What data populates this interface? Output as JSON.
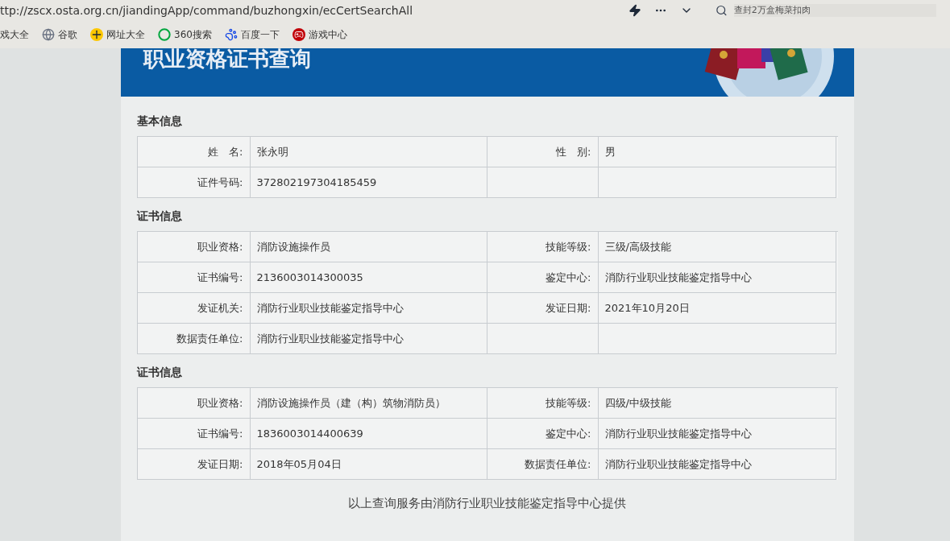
{
  "address_bar": {
    "url": "ttp://zscx.osta.org.cn/jiandingApp/command/buzhongxin/ecCertSearchAll"
  },
  "search": {
    "placeholder": "查封2万盒梅菜扣肉"
  },
  "bookmarks": [
    {
      "label": "戏大全",
      "kind": "none"
    },
    {
      "label": "谷歌",
      "kind": "globe"
    },
    {
      "label": "网址大全",
      "kind": "plus"
    },
    {
      "label": "360搜索",
      "kind": "ring"
    },
    {
      "label": "百度一下",
      "kind": "paw"
    },
    {
      "label": "游戏中心",
      "kind": "game"
    }
  ],
  "page": {
    "title": "职业资格证书查询",
    "sections": [
      {
        "title": "基本信息",
        "rows": [
          [
            {
              "label": "姓　名:",
              "value": "张永明"
            },
            {
              "label": "性　别:",
              "value": "男"
            }
          ],
          [
            {
              "label": "证件号码:",
              "value": "372802197304185459"
            }
          ]
        ]
      },
      {
        "title": "证书信息",
        "rows": [
          [
            {
              "label": "职业资格:",
              "value": "消防设施操作员"
            },
            {
              "label": "技能等级:",
              "value": "三级/高级技能"
            }
          ],
          [
            {
              "label": "证书编号:",
              "value": "2136003014300035"
            },
            {
              "label": "鉴定中心:",
              "value": "消防行业职业技能鉴定指导中心"
            }
          ],
          [
            {
              "label": "发证机关:",
              "value": "消防行业职业技能鉴定指导中心"
            },
            {
              "label": "发证日期:",
              "value": "2021年10月20日"
            }
          ],
          [
            {
              "label": "数据责任单位:",
              "value": "消防行业职业技能鉴定指导中心"
            }
          ]
        ]
      },
      {
        "title": "证书信息",
        "rows": [
          [
            {
              "label": "职业资格:",
              "value": "消防设施操作员（建（构）筑物消防员）"
            },
            {
              "label": "技能等级:",
              "value": "四级/中级技能"
            }
          ],
          [
            {
              "label": "证书编号:",
              "value": "1836003014400639"
            },
            {
              "label": "鉴定中心:",
              "value": "消防行业职业技能鉴定指导中心"
            }
          ],
          [
            {
              "label": "发证日期:",
              "value": "2018年05月04日"
            },
            {
              "label": "数据责任单位:",
              "value": "消防行业职业技能鉴定指导中心"
            }
          ]
        ]
      }
    ],
    "footer": "以上查询服务由消防行业职业技能鉴定指导中心提供"
  }
}
